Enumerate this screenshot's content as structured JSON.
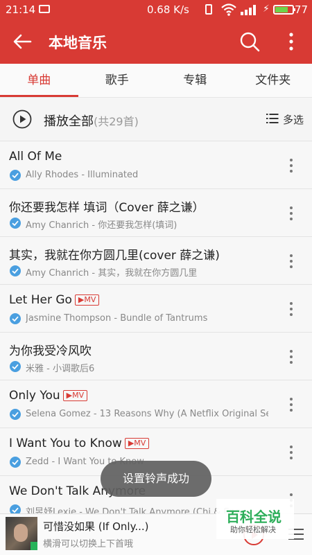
{
  "status_bar": {
    "time": "21:14",
    "network_speed": "0.68 K/s",
    "battery_percent": "77",
    "battery_fraction": 0.77
  },
  "app_bar": {
    "title": "本地音乐",
    "back_icon": "arrow-left-icon",
    "search_icon": "search-icon",
    "more_icon": "more-vertical-icon"
  },
  "tabs": [
    {
      "label": "单曲",
      "active": true
    },
    {
      "label": "歌手",
      "active": false
    },
    {
      "label": "专辑",
      "active": false
    },
    {
      "label": "文件夹",
      "active": false
    }
  ],
  "play_all": {
    "label": "播放全部",
    "count": "(共29首)",
    "multi_select_label": "多选"
  },
  "songs": [
    {
      "title": "All Of Me",
      "mv": false,
      "subtitle": "Ally Rhodes - Illuminated"
    },
    {
      "title": "你还要我怎样 填词（Cover 薛之谦）",
      "mv": false,
      "subtitle": "Amy Chanrich - 你还要我怎样(填词)"
    },
    {
      "title": "其实，我就在你方圆几里(cover 薛之谦)",
      "mv": false,
      "subtitle": "Amy Chanrich - 其实，我就在你方圆几里"
    },
    {
      "title": "Let Her Go",
      "mv": true,
      "subtitle": "Jasmine Thompson - Bundle of Tantrums"
    },
    {
      "title": "为你我受冷风吹",
      "mv": false,
      "subtitle": "米雅 - 小调歌后6"
    },
    {
      "title": "Only You",
      "mv": true,
      "subtitle": "Selena Gomez - 13 Reasons Why (A Netflix Original Series S.."
    },
    {
      "title": "I Want You to Know",
      "mv": true,
      "subtitle": "Zedd - I Want You to Know"
    },
    {
      "title": "We Don't Talk Anymore",
      "mv": false,
      "subtitle": "刘昱妤Lexie - We Don't Talk Anymore (Chi & Eng"
    }
  ],
  "mv_badge": "MV",
  "toast": "设置铃声成功",
  "player": {
    "title": "可惜没如果 (If Only...)",
    "hint": "横滑可以切换上下首哦"
  },
  "watermark": {
    "title": "百科全说",
    "subtitle": "助你轻松解决"
  },
  "colors": {
    "accent": "#d83a34",
    "check": "#4a9fe0",
    "battery": "#6fd24a"
  }
}
